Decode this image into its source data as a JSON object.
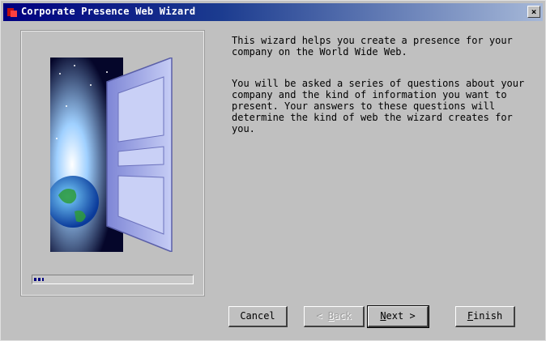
{
  "window": {
    "title": "Corporate Presence Web Wizard",
    "close_symbol": "×"
  },
  "content": {
    "paragraph1": "This wizard helps you create a presence for your company on the World Wide Web.",
    "paragraph2": "You will be asked a series of questions about your company and the kind of information you want to present. Your answers to these questions will determine the kind of web the wizard creates for you."
  },
  "progress": {
    "value": 0.06
  },
  "buttons": {
    "cancel": "Cancel",
    "back": {
      "prefix": "< ",
      "mnemonic": "B",
      "rest": "ack"
    },
    "next": {
      "mnemonic": "N",
      "rest": "ext >"
    },
    "finish": {
      "mnemonic": "F",
      "rest": "inish"
    }
  },
  "icons": [
    "app-icon",
    "close-icon",
    "open-door-globe-illustration"
  ],
  "colors": {
    "titlebar_start": "#000080",
    "titlebar_end": "#a6b8d8",
    "face": "#c0c0c0"
  }
}
